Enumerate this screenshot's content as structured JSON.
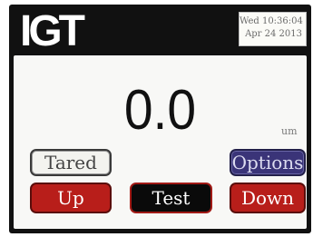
{
  "header": {
    "logo_text": "IGT",
    "clock": {
      "time_line": "Wed 10:36:04",
      "date_line": "Apr 24 2013"
    }
  },
  "display": {
    "reading": "0.0",
    "unit": "um"
  },
  "buttons": {
    "tared": "Tared",
    "options": "Options",
    "up": "Up",
    "test": "Test",
    "down": "Down"
  },
  "colors": {
    "accent_red": "#b81e1a",
    "options_purple": "#3a3478",
    "screen_black": "#111111"
  }
}
